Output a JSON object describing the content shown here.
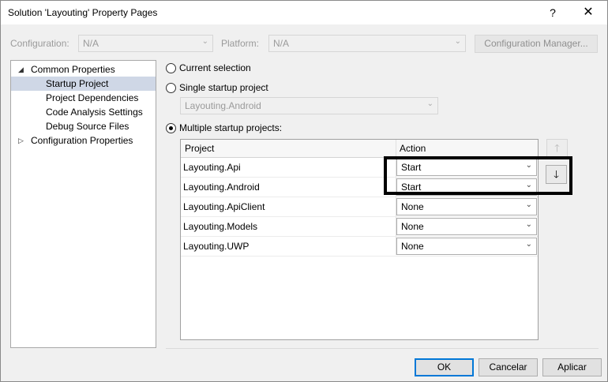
{
  "window": {
    "title": "Solution 'Layouting' Property Pages",
    "help_glyph": "?",
    "close_glyph": "✕"
  },
  "toolbar": {
    "configuration_label": "Configuration:",
    "configuration_value": "N/A",
    "platform_label": "Platform:",
    "platform_value": "N/A",
    "config_manager_label": "Configuration Manager..."
  },
  "tree": {
    "items": [
      {
        "label": "Common Properties",
        "expander": "◢"
      },
      {
        "label": "Startup Project"
      },
      {
        "label": "Project Dependencies"
      },
      {
        "label": "Code Analysis Settings"
      },
      {
        "label": "Debug Source Files"
      },
      {
        "label": "Configuration Properties",
        "expander": "▷"
      }
    ],
    "selected_index": 1
  },
  "options": {
    "current_selection": "Current selection",
    "single_startup": "Single startup project",
    "single_startup_value": "Layouting.Android",
    "multiple_startup": "Multiple startup projects:",
    "checked": "multiple"
  },
  "grid": {
    "columns": [
      "Project",
      "Action"
    ],
    "rows": [
      {
        "project": "Layouting.Api",
        "action": "Start"
      },
      {
        "project": "Layouting.Android",
        "action": "Start"
      },
      {
        "project": "Layouting.ApiClient",
        "action": "None"
      },
      {
        "project": "Layouting.Models",
        "action": "None"
      },
      {
        "project": "Layouting.UWP",
        "action": "None"
      }
    ]
  },
  "move_buttons": {
    "up": "🡑",
    "down": "🡓"
  },
  "buttons": {
    "ok": "OK",
    "cancel": "Cancelar",
    "apply": "Aplicar"
  },
  "colors": {
    "selection": "#cfd7e6",
    "default_button_border": "#0078d7",
    "highlight_box": "#000000"
  }
}
